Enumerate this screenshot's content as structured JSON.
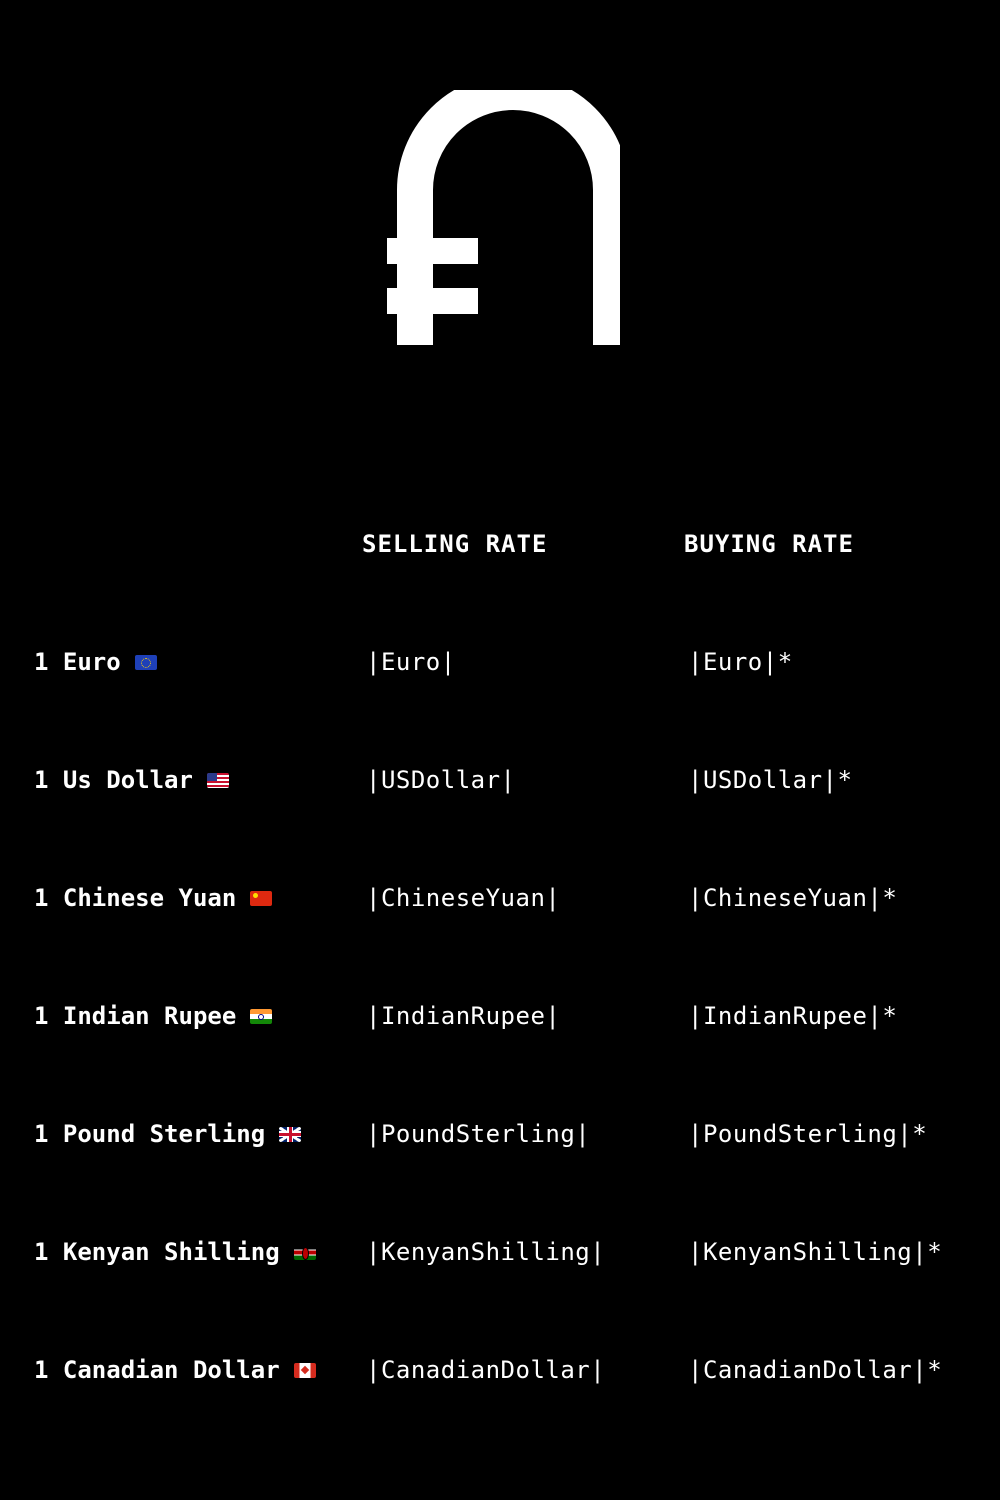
{
  "logo": {
    "icon": "dram-sign-icon",
    "color": "#ffffff"
  },
  "headers": {
    "selling": "SELLING RATE",
    "buying": "BUYING RATE"
  },
  "rows": [
    {
      "name": "1 Euro",
      "flag": "flag-eu-icon",
      "selling": "|Euro|",
      "buying": "|Euro|*"
    },
    {
      "name": "1 Us Dollar",
      "flag": "flag-us-icon",
      "selling": "|USDollar|",
      "buying": "|USDollar|*"
    },
    {
      "name": "1 Chinese Yuan",
      "flag": "flag-cn-icon",
      "selling": "|ChineseYuan|",
      "buying": "|ChineseYuan|*"
    },
    {
      "name": "1 Indian Rupee",
      "flag": "flag-in-icon",
      "selling": "|IndianRupee|",
      "buying": "|IndianRupee|*"
    },
    {
      "name": "1 Pound Sterling",
      "flag": "flag-gb-icon",
      "selling": "|PoundSterling|",
      "buying": "|PoundSterling|*"
    },
    {
      "name": "1 Kenyan Shilling",
      "flag": "flag-ke-icon",
      "selling": "|KenyanShilling|",
      "buying": "|KenyanShilling|*"
    },
    {
      "name": "1 Canadian Dollar",
      "flag": "flag-ca-icon",
      "selling": "|CanadianDollar|",
      "buying": "|CanadianDollar|*"
    }
  ],
  "colors": {
    "background": "#000000",
    "text": "#ffffff"
  }
}
